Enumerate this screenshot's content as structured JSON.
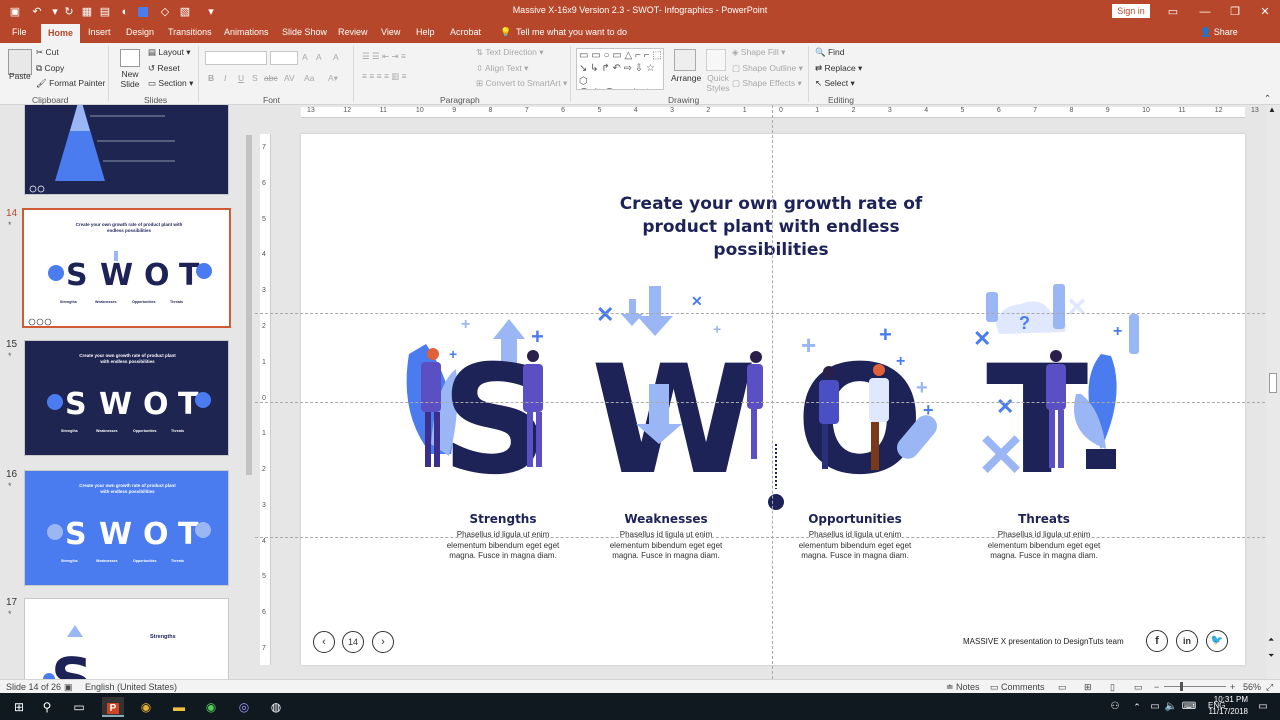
{
  "title_bar": {
    "title": "Massive X-16x9 Version 2.3 - SWOT- Infographics - PowerPoint",
    "sign_in": "Sign in",
    "controls": [
      "▭",
      "—",
      "❐",
      "✕"
    ]
  },
  "tabs": [
    "File",
    "Home",
    "Insert",
    "Design",
    "Transitions",
    "Animations",
    "Slide Show",
    "Review",
    "View",
    "Help",
    "Acrobat"
  ],
  "tell_me": "Tell me what you want to do",
  "share": "Share",
  "ribbon": {
    "clipboard": {
      "paste": "Paste",
      "cut": "Cut",
      "copy": "Copy",
      "format_painter": "Format Painter",
      "group": "Clipboard"
    },
    "slides": {
      "new_slide": "New Slide",
      "layout": "Layout",
      "reset": "Reset",
      "section": "Section",
      "group": "Slides"
    },
    "font": {
      "group": "Font",
      "bold": "B",
      "italic": "I",
      "underline": "U",
      "strike": "S",
      "shadow": "abc",
      "spacing": "AV",
      "case": "Aa",
      "grow": "A",
      "shrink": "A",
      "clear": "A"
    },
    "paragraph": {
      "group": "Paragraph",
      "text_direction": "Text Direction",
      "align_text": "Align Text",
      "convert_smartart": "Convert to SmartArt"
    },
    "drawing": {
      "group": "Drawing",
      "arrange": "Arrange",
      "quick_styles": "Quick Styles",
      "shape_fill": "Shape Fill",
      "shape_outline": "Shape Outline",
      "shape_effects": "Shape Effects"
    },
    "editing": {
      "group": "Editing",
      "find": "Find",
      "replace": "Replace",
      "select": "Select"
    }
  },
  "thumbnails": [
    {
      "number": "14",
      "star": "*",
      "selected": true,
      "title": "Create your own growth rate of product plant with endless possibilities",
      "labels": [
        "Strengths",
        "Weaknesses",
        "Opportunities",
        "Threats"
      ]
    },
    {
      "number": "15",
      "star": "*",
      "selected": false,
      "title": "Create your own growth rate of product plant with endless possibilities",
      "labels": [
        "Strengths",
        "Weaknesses",
        "Opportunities",
        "Threats"
      ]
    },
    {
      "number": "16",
      "star": "*",
      "selected": false,
      "title": "Create your own growth rate of product plant with endless possibilities",
      "labels": [
        "Strengths",
        "Weaknesses",
        "Opportunities",
        "Threats"
      ]
    },
    {
      "number": "17",
      "star": "*",
      "selected": false,
      "title": "Strengths"
    }
  ],
  "ruler_h": [
    "13",
    "12",
    "11",
    "10",
    "9",
    "8",
    "7",
    "6",
    "5",
    "4",
    "3",
    "2",
    "1",
    "0",
    "1",
    "2",
    "3",
    "4",
    "5",
    "6",
    "7",
    "8",
    "9",
    "10",
    "11",
    "12",
    "13"
  ],
  "ruler_v": [
    "7",
    "6",
    "5",
    "4",
    "3",
    "2",
    "1",
    "0",
    "1",
    "2",
    "3",
    "4",
    "5",
    "6",
    "7"
  ],
  "slide": {
    "title_line1": "Create your own growth rate of",
    "title_line2": "product plant with endless possibilities",
    "letters": [
      "S",
      "W",
      "O",
      "T"
    ],
    "columns": [
      {
        "label": "Strengths",
        "desc": "Phasellus id ligula ut enim elementum bibendum eget eget magna. Fusce in magna diam."
      },
      {
        "label": "Weaknesses",
        "desc": "Phasellus id ligula ut enim elementum bibendum eget eget magna. Fusce in magna diam."
      },
      {
        "label": "Opportunities",
        "desc": "Phasellus id ligula ut enim elementum bibendum eget eget magna. Fusce in magna diam."
      },
      {
        "label": "Threats",
        "desc": "Phasellus id ligula ut enim elementum bibendum eget eget magna. Fusce in magna diam."
      }
    ],
    "page_number": "14",
    "footer": "MASSIVE X presentation to DesignTuts team",
    "social": [
      "f",
      "in",
      "t"
    ]
  },
  "status_bar": {
    "slide_info": "Slide 14 of 26",
    "language": "English (United States)",
    "notes": "Notes",
    "comments": "Comments",
    "zoom": "56%"
  },
  "taskbar": {
    "language": "ENG",
    "time": "10:31 PM",
    "date": "11/17/2018"
  },
  "colors": {
    "accent": "#b7472a",
    "navy": "#1d2257",
    "blue": "#4a7cf0",
    "light_blue": "#9bb6f5",
    "purple": "#5b4fc4"
  }
}
